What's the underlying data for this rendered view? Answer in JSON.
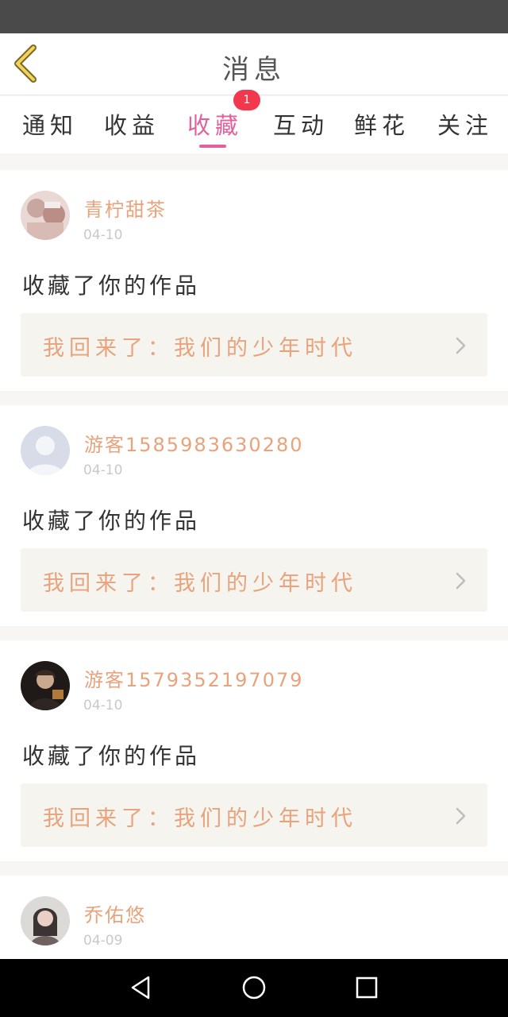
{
  "header": {
    "title": "消息"
  },
  "tabs": [
    {
      "label": "通知",
      "active": false
    },
    {
      "label": "收益",
      "active": false
    },
    {
      "label": "收藏",
      "active": true,
      "badge": "1"
    },
    {
      "label": "互动",
      "active": false
    },
    {
      "label": "鲜花",
      "active": false
    },
    {
      "label": "关注",
      "active": false
    }
  ],
  "colors": {
    "accent": "#e4609c",
    "badge": "#f2384c",
    "username": "#e8a27c",
    "link_bg": "#f5f4ee"
  },
  "messages": [
    {
      "username": "青柠甜茶",
      "date": "04-10",
      "action": "收藏了你的作品",
      "work_title": "我回来了：我们的少年时代",
      "avatar_icon": "avatar-photo"
    },
    {
      "username": "游客1585983630280",
      "date": "04-10",
      "action": "收藏了你的作品",
      "work_title": "我回来了：我们的少年时代",
      "avatar_icon": "default-user-icon"
    },
    {
      "username": "游客1579352197079",
      "date": "04-10",
      "action": "收藏了你的作品",
      "work_title": "我回来了：我们的少年时代",
      "avatar_icon": "avatar-photo"
    },
    {
      "username": "乔佑悠",
      "date": "04-09",
      "action": "",
      "work_title": "",
      "avatar_icon": "avatar-photo"
    }
  ]
}
